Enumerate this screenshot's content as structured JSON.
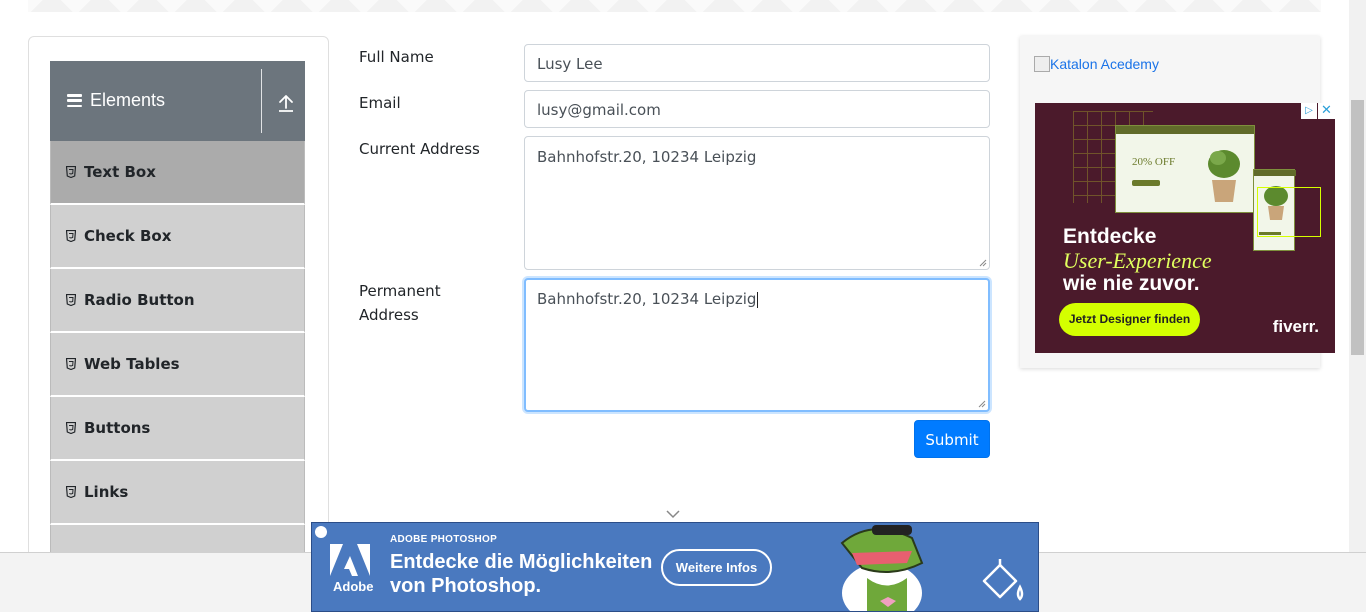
{
  "sidebar": {
    "group_title": "Elements",
    "items": [
      {
        "label": "Text Box",
        "active": true
      },
      {
        "label": "Check Box",
        "active": false
      },
      {
        "label": "Radio Button",
        "active": false
      },
      {
        "label": "Web Tables",
        "active": false
      },
      {
        "label": "Buttons",
        "active": false
      },
      {
        "label": "Links",
        "active": false
      }
    ]
  },
  "form": {
    "full_name_label": "Full Name",
    "full_name_value": "Lusy Lee",
    "email_label": "Email",
    "email_value": "lusy@gmail.com",
    "current_address_label": "Current Address",
    "current_address_value": "Bahnhofstr.20, 10234 Leipzig",
    "permanent_address_label_line1": "Permanent",
    "permanent_address_label_line2": "Address",
    "permanent_address_value": "Bahnhofstr.20, 10234 Leipzig",
    "submit_label": "Submit"
  },
  "right_ad": {
    "katalon_link": "Katalon Acedemy",
    "mock_offer": "20% OFF",
    "headline_1": "Entdecke",
    "headline_2": "User-Experience",
    "headline_3": "wie nie zuvor.",
    "cta": "Jetzt Designer finden",
    "brand": "fiverr."
  },
  "bottom_ad": {
    "product": "ADOBE PHOTOSHOP",
    "headline_1": "Entdecke die Möglichkeiten",
    "headline_2": "von Photoshop.",
    "cta": "Weitere Infos",
    "brand": "Adobe"
  },
  "colors": {
    "primary": "#007bff",
    "group_header": "#6c757d",
    "menu_item": "#d0d0d0",
    "menu_item_active": "#ababab",
    "fiverr_bg": "#4b1a2b",
    "fiverr_accent": "#d4ff00",
    "adobe_bg": "#4a79bf"
  },
  "icons": [
    "hamburger-icon",
    "upload-icon",
    "html5-icon",
    "ad-choices-icon",
    "close-icon",
    "chevron-down-icon",
    "broken-image-icon",
    "adobe-logo-icon",
    "paint-bucket-icon"
  ]
}
